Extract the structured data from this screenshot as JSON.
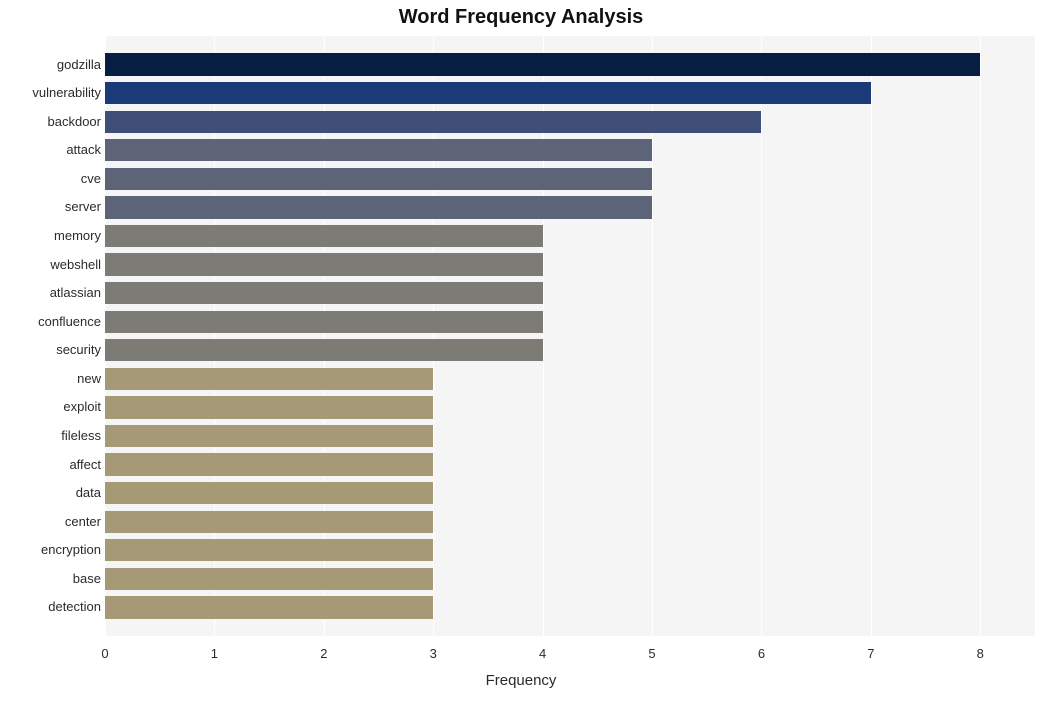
{
  "chart_data": {
    "type": "bar",
    "orientation": "horizontal",
    "title": "Word Frequency Analysis",
    "xlabel": "Frequency",
    "ylabel": "",
    "xlim": [
      0,
      8.5
    ],
    "x_ticks": [
      0,
      1,
      2,
      3,
      4,
      5,
      6,
      7,
      8
    ],
    "categories": [
      "godzilla",
      "vulnerability",
      "backdoor",
      "attack",
      "cve",
      "server",
      "memory",
      "webshell",
      "atlassian",
      "confluence",
      "security",
      "new",
      "exploit",
      "fileless",
      "affect",
      "data",
      "center",
      "encryption",
      "base",
      "detection"
    ],
    "values": [
      8,
      7,
      6,
      5,
      5,
      5,
      4,
      4,
      4,
      4,
      4,
      3,
      3,
      3,
      3,
      3,
      3,
      3,
      3,
      3
    ],
    "colors": [
      "#071d41",
      "#1b3a77",
      "#3e4e76",
      "#5e6478",
      "#5e6478",
      "#5e6478",
      "#7d7b76",
      "#7d7b76",
      "#7d7b76",
      "#7d7b76",
      "#7d7b76",
      "#a59a75",
      "#a59a75",
      "#a59a75",
      "#a59a75",
      "#a59a75",
      "#a59a75",
      "#a59a75",
      "#a59a75",
      "#a59a75"
    ]
  }
}
